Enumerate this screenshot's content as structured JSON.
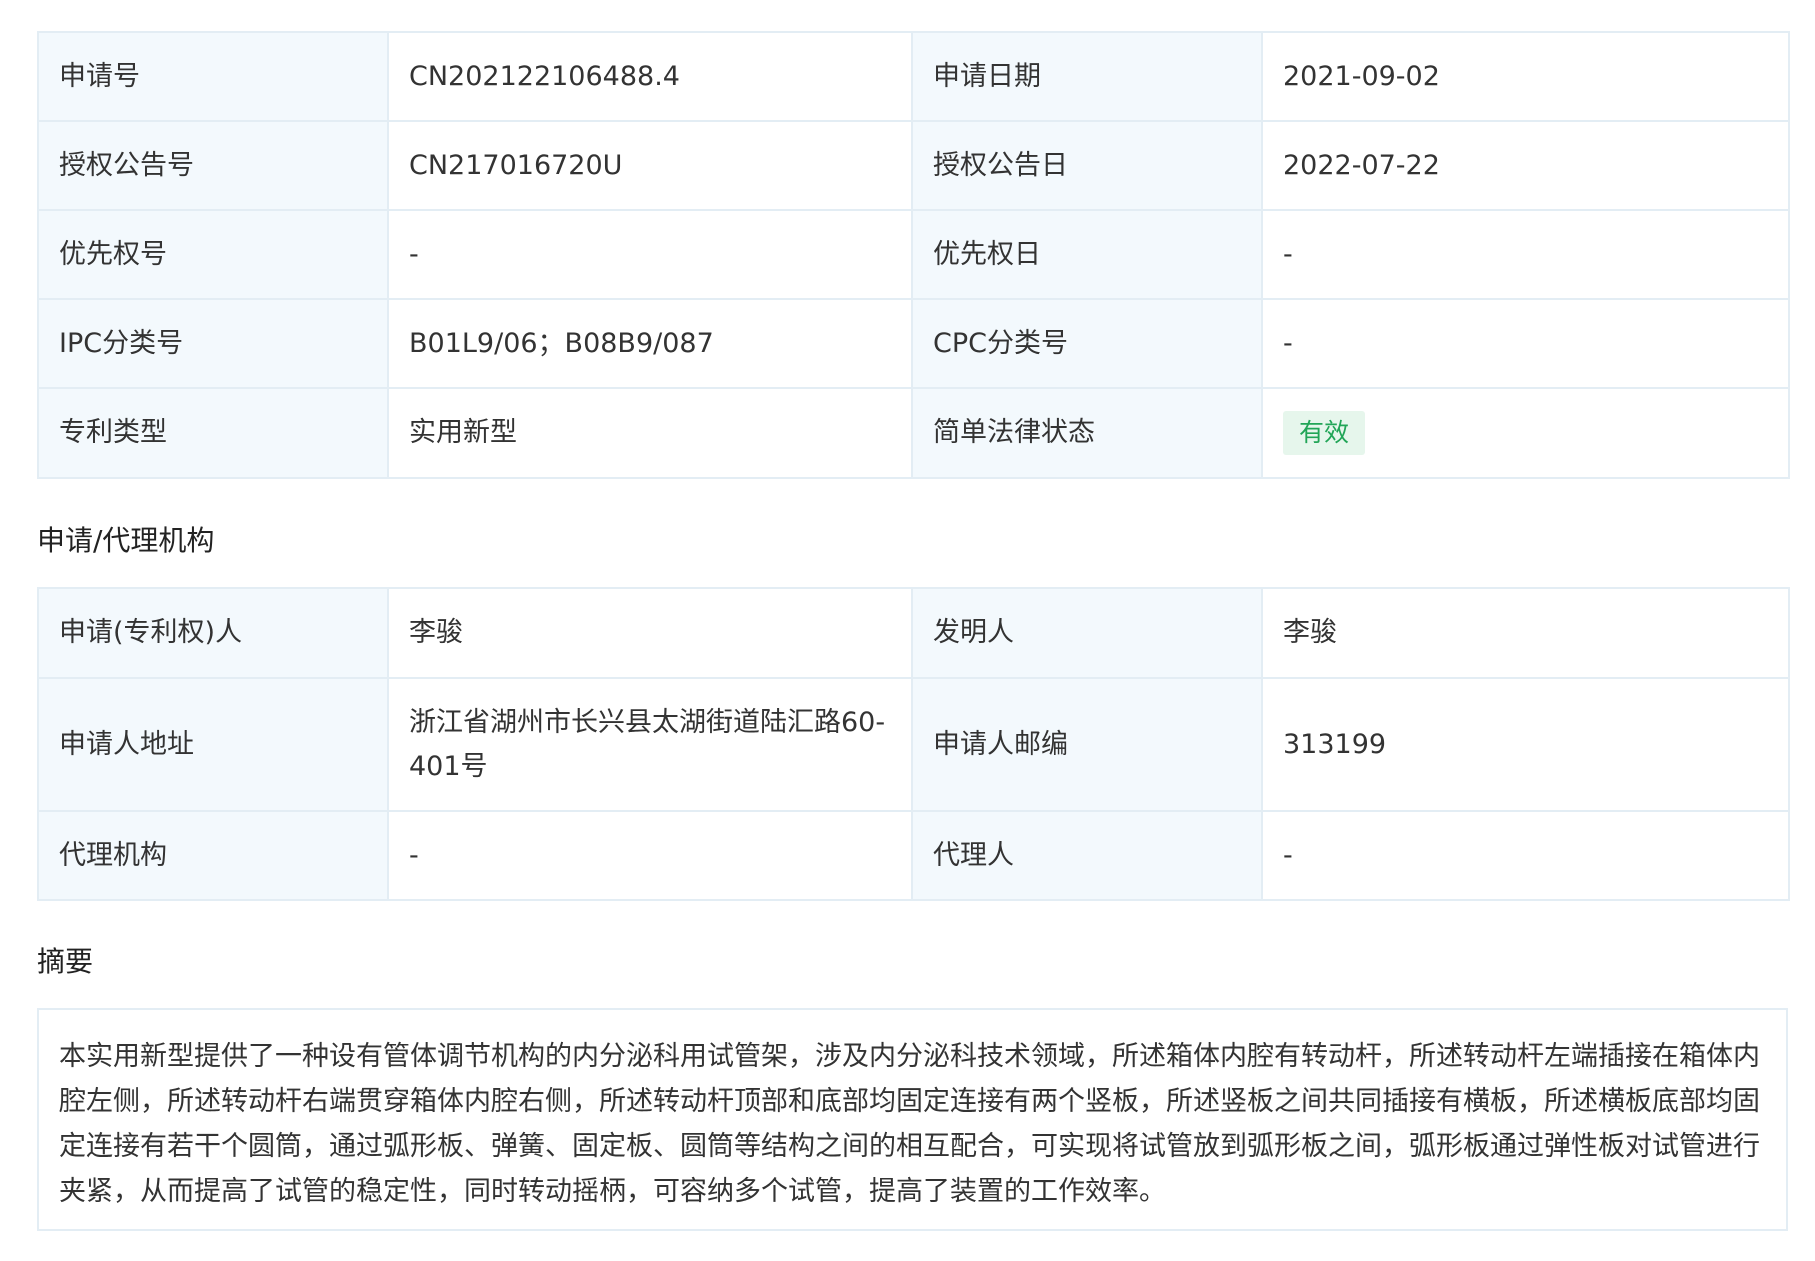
{
  "basic_info": {
    "application_no_label": "申请号",
    "application_no": "CN202122106488.4",
    "application_date_label": "申请日期",
    "application_date": "2021-09-02",
    "grant_pub_no_label": "授权公告号",
    "grant_pub_no": "CN217016720U",
    "grant_pub_date_label": "授权公告日",
    "grant_pub_date": "2022-07-22",
    "priority_no_label": "优先权号",
    "priority_no": "-",
    "priority_date_label": "优先权日",
    "priority_date": "-",
    "ipc_label": "IPC分类号",
    "ipc": "B01L9/06；B08B9/087",
    "cpc_label": "CPC分类号",
    "cpc": "-",
    "patent_type_label": "专利类型",
    "patent_type": "实用新型",
    "legal_status_label": "简单法律状态",
    "legal_status": "有效"
  },
  "agency": {
    "section_title": "申请/代理机构",
    "applicant_label": "申请(专利权)人",
    "applicant": "李骏",
    "inventor_label": "发明人",
    "inventor": "李骏",
    "address_label": "申请人地址",
    "address": "浙江省湖州市长兴县太湖街道陆汇路60-401号",
    "postcode_label": "申请人邮编",
    "postcode": "313199",
    "agency_label": "代理机构",
    "agency_value": "-",
    "agent_label": "代理人",
    "agent_value": "-"
  },
  "abstract": {
    "section_title": "摘要",
    "text": "本实用新型提供了一种设有管体调节机构的内分泌科用试管架，涉及内分泌科技术领域，所述箱体内腔有转动杆，所述转动杆左端插接在箱体内腔左侧，所述转动杆右端贯穿箱体内腔右侧，所述转动杆顶部和底部均固定连接有两个竖板，所述竖板之间共同插接有横板，所述横板底部均固定连接有若干个圆筒，通过弧形板、弹簧、固定板、圆筒等结构之间的相互配合，可实现将试管放到弧形板之间，弧形板通过弹性板对试管进行夹紧，从而提高了试管的稳定性，同时转动摇柄，可容纳多个试管，提高了装置的工作效率。"
  },
  "colors": {
    "label_bg": "#f3f9fd",
    "border": "#e3edf4",
    "status_green": "#21a557",
    "status_bg": "#e6f6ec"
  }
}
